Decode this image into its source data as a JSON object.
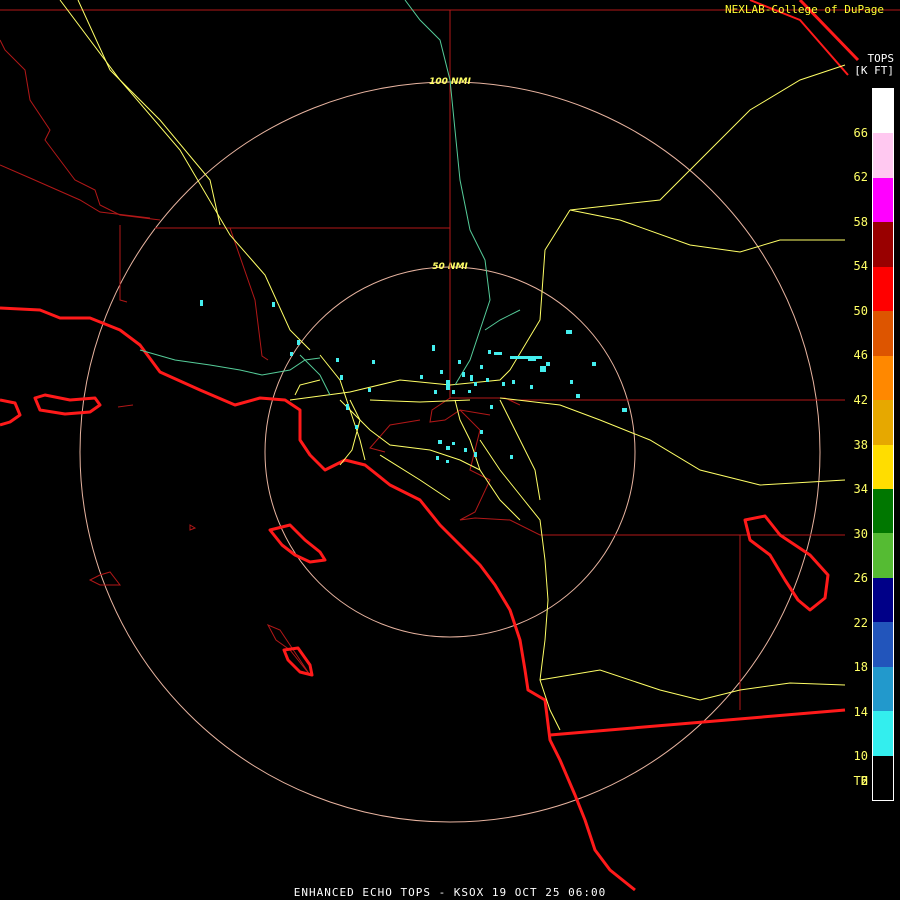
{
  "credit": "NEXLAB-College of DuPage",
  "footer": "ENHANCED ECHO TOPS - KSOX 19 OCT 25 06:00",
  "legend": {
    "title_lines": [
      "TOPS",
      "[K FT]"
    ],
    "ticks": [
      "66",
      "62",
      "58",
      "54",
      "50",
      "46",
      "42",
      "38",
      "34",
      "30",
      "26",
      "22",
      "18",
      "14",
      "10",
      "6",
      "2",
      "TH"
    ],
    "colors": [
      "#ffffff",
      "#ffc8f0",
      "#ff00ff",
      "#990000",
      "#ff0000",
      "#dd5500",
      "#ff8800",
      "#e6a800",
      "#ffdd00",
      "#007700",
      "#55bb33",
      "#000088",
      "#2255bb",
      "#2299cc",
      "#33eeee",
      "#000000"
    ]
  },
  "range_rings": [
    {
      "label": "100 NMI"
    },
    {
      "label": "50 NMI"
    }
  ],
  "colors": {
    "coast": "#ff1a1a",
    "borders": "#b21818",
    "highways": "#ffff66",
    "roads": "#55cc99",
    "rings": "#e8b4a0",
    "echo": "#44eeee"
  }
}
